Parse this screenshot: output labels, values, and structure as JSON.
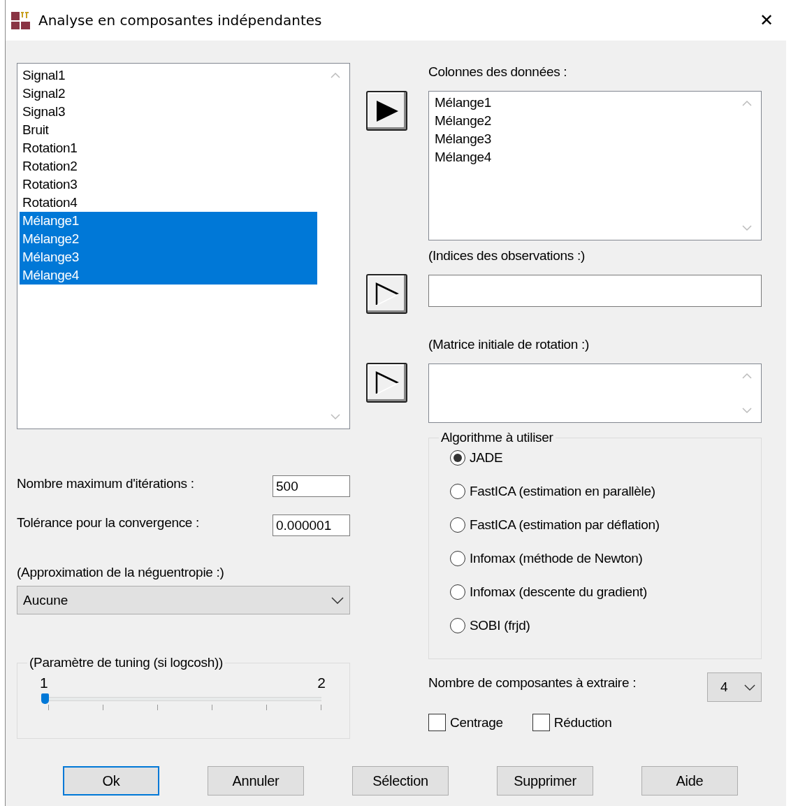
{
  "window": {
    "title": "Analyse en composantes indépendantes",
    "close": "✕"
  },
  "variables": [
    {
      "label": "Signal1",
      "selected": false
    },
    {
      "label": "Signal2",
      "selected": false
    },
    {
      "label": "Signal3",
      "selected": false
    },
    {
      "label": "Bruit",
      "selected": false
    },
    {
      "label": "Rotation1",
      "selected": false
    },
    {
      "label": "Rotation2",
      "selected": false
    },
    {
      "label": "Rotation3",
      "selected": false
    },
    {
      "label": "Rotation4",
      "selected": false
    },
    {
      "label": "Mélange1",
      "selected": true
    },
    {
      "label": "Mélange2",
      "selected": true
    },
    {
      "label": "Mélange3",
      "selected": true
    },
    {
      "label": "Mélange4",
      "selected": true
    }
  ],
  "data_columns": {
    "label": "Colonnes des données :",
    "items": [
      "Mélange1",
      "Mélange2",
      "Mélange3",
      "Mélange4"
    ]
  },
  "observation_indices": {
    "label": "(Indices des observations :)"
  },
  "initial_rotation": {
    "label": "(Matrice initiale de rotation :)"
  },
  "max_iterations": {
    "label": "Nombre maximum d'itérations :",
    "value": "500"
  },
  "tolerance": {
    "label": "Tolérance pour la convergence :",
    "value": "0.000001"
  },
  "negentropy": {
    "label": "(Approximation de la néguentropie :)",
    "value": "Aucune"
  },
  "tuning": {
    "label": "(Paramètre de tuning (si logcosh))",
    "min": "1",
    "max": "2",
    "level": 0
  },
  "algorithm": {
    "label": "Algorithme à utiliser",
    "options": [
      {
        "label": "JADE",
        "selected": true
      },
      {
        "label": "FastICA (estimation en parallèle)",
        "selected": false
      },
      {
        "label": "FastICA (estimation par déflation)",
        "selected": false
      },
      {
        "label": "Infomax (méthode de Newton)",
        "selected": false
      },
      {
        "label": "Infomax (descente du gradient)",
        "selected": false
      },
      {
        "label": "SOBI (frjd)",
        "selected": false
      }
    ]
  },
  "components": {
    "label": "Nombre de composantes à extraire :",
    "value": "4"
  },
  "options": [
    {
      "label": "Centrage",
      "checked": false
    },
    {
      "label": "Réduction",
      "checked": false
    }
  ],
  "buttons": [
    {
      "label": "Ok",
      "default": true
    },
    {
      "label": "Annuler",
      "default": false
    },
    {
      "label": "Sélection",
      "default": false
    },
    {
      "label": "Supprimer",
      "default": false
    },
    {
      "label": "Aide",
      "default": false
    }
  ]
}
